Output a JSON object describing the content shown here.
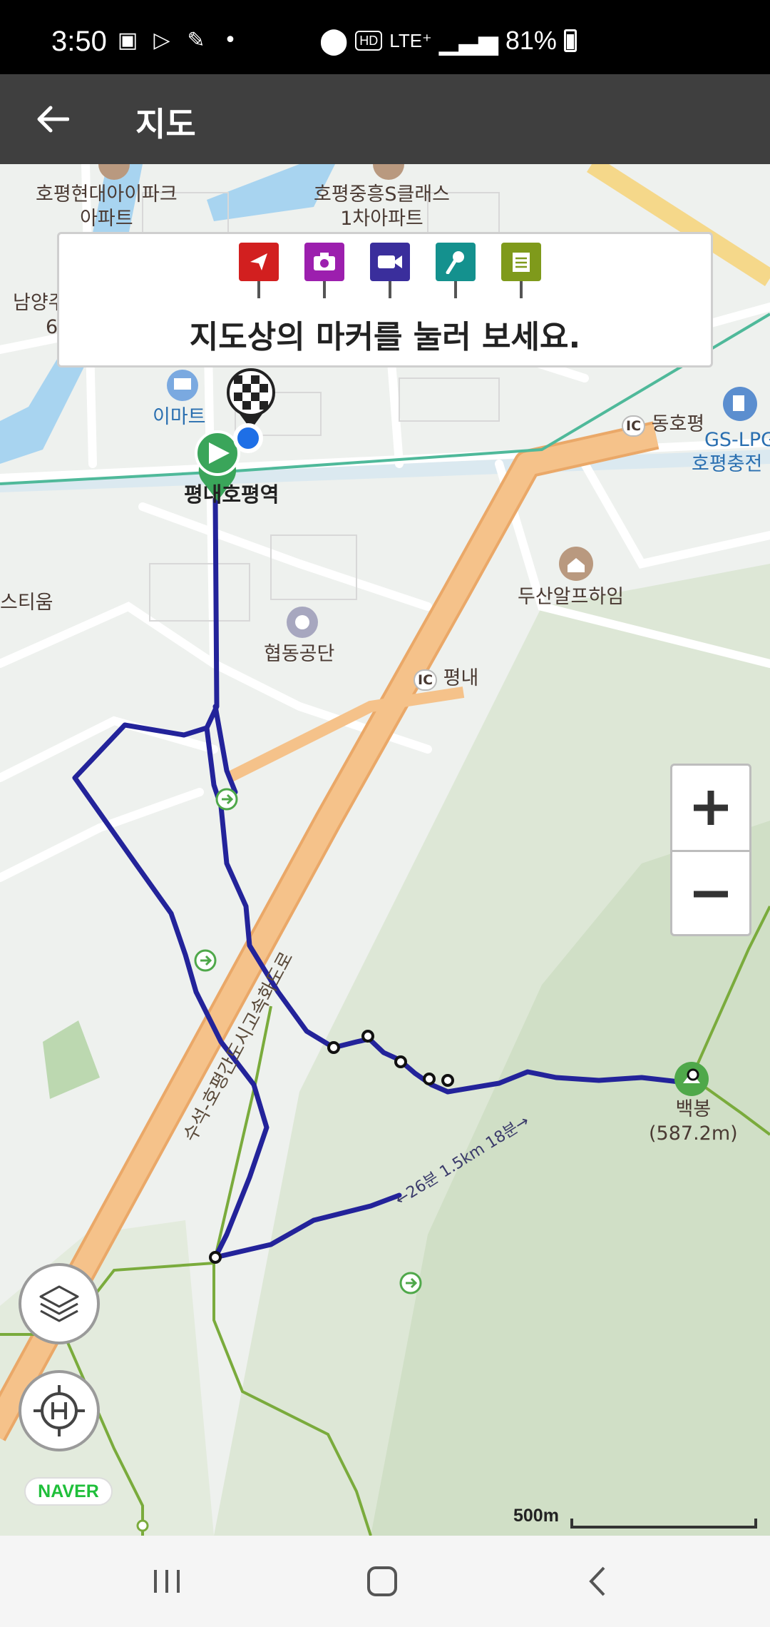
{
  "status_bar": {
    "time": "3:50",
    "network_chip": "HD",
    "lte": "LTE⁺",
    "battery": "81%"
  },
  "app_bar": {
    "title": "지도"
  },
  "info_card": {
    "message": "지도상의 마커를 눌러 보세요.",
    "markers": [
      {
        "name": "direction-marker",
        "color": "#d21f1f"
      },
      {
        "name": "camera-marker",
        "color": "#9c1fae"
      },
      {
        "name": "video-marker",
        "color": "#3a2e9c"
      },
      {
        "name": "mic-marker",
        "color": "#14918e"
      },
      {
        "name": "note-marker",
        "color": "#7f9a1b"
      }
    ]
  },
  "map": {
    "labels": {
      "apt1_line1": "호평현대아이파크",
      "apt1_line2": "아파트",
      "apt2_line1": "호평중흥S클래스",
      "apt2_line2": "1차아파트",
      "namyang": "남양주",
      "namyang_num": "6",
      "emart": "이마트",
      "station": "평내호평역",
      "ic1_badge": "IC",
      "ic1": "동호평",
      "gs": "GS-LPG",
      "gs2": "호평충전",
      "doosan": "두산알프하임",
      "hyeopdong": "협동공단",
      "ic2_badge": "IC",
      "ic2": "평내",
      "tium": "스티움",
      "highway": "수석-호평간도시고속화도로",
      "route_info": "←26분 1.5km 18분→",
      "peak": "백봉",
      "peak_height": "(587.2m)"
    },
    "attribution": "NAVER",
    "scale_label": "500m"
  },
  "zoom": {
    "plus": "+",
    "minus": "−"
  },
  "colors": {
    "route": "#23239a",
    "highway": "#f5c28a",
    "trail": "#7aab3c",
    "water": "#a8d4f0",
    "forest": "#d6e3cf"
  }
}
